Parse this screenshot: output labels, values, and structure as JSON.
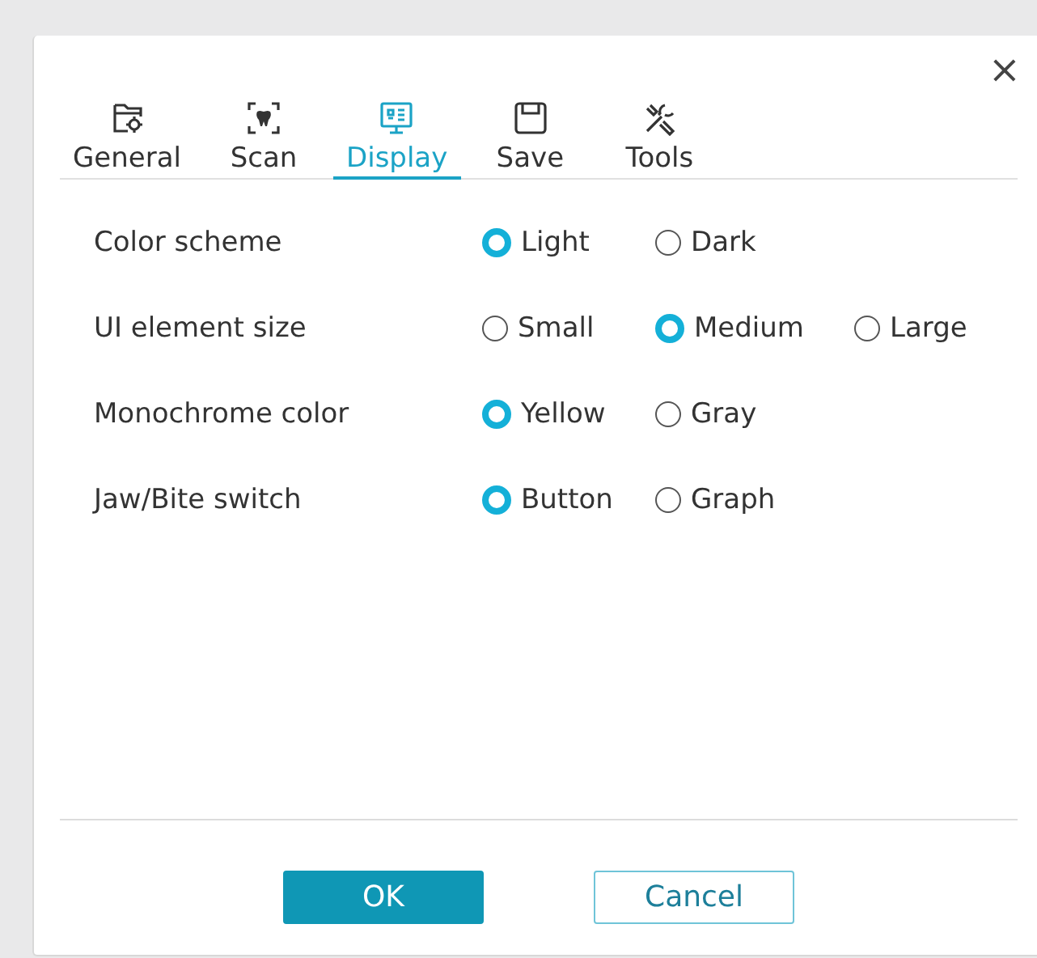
{
  "close_button": "×",
  "tabs": [
    {
      "label": "General",
      "kind": "general",
      "selected": false
    },
    {
      "label": "Scan",
      "kind": "scan",
      "selected": false
    },
    {
      "label": "Display",
      "kind": "display",
      "selected": true
    },
    {
      "label": "Save",
      "kind": "save",
      "selected": false
    },
    {
      "label": "Tools",
      "kind": "tools",
      "selected": false
    }
  ],
  "settings": [
    {
      "label": "Color scheme",
      "options": [
        {
          "label": "Light",
          "selected": true
        },
        {
          "label": "Dark",
          "selected": false
        }
      ]
    },
    {
      "label": "UI element size",
      "options": [
        {
          "label": "Small",
          "selected": false
        },
        {
          "label": "Medium",
          "selected": true
        },
        {
          "label": "Large",
          "selected": false
        }
      ]
    },
    {
      "label": "Monochrome color",
      "options": [
        {
          "label": "Yellow",
          "selected": true
        },
        {
          "label": "Gray",
          "selected": false
        }
      ]
    },
    {
      "label": "Jaw/Bite switch",
      "options": [
        {
          "label": "Button",
          "selected": true
        },
        {
          "label": "Graph",
          "selected": false
        }
      ]
    }
  ],
  "buttons": [
    {
      "label": "OK",
      "kind": "primary"
    },
    {
      "label": "Cancel",
      "kind": "secondary"
    }
  ]
}
